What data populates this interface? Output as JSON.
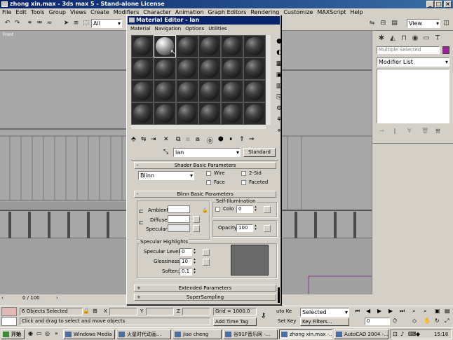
{
  "window": {
    "title": "zhong xin.max - 3ds max 5 - Stand-alone License"
  },
  "menu": [
    "File",
    "Edit",
    "Tools",
    "Group",
    "Views",
    "Create",
    "Modifiers",
    "Character",
    "Animation",
    "Graph Editors",
    "Rendering",
    "Customize",
    "MAXScript",
    "Help"
  ],
  "toolbar": {
    "selection_filter": "All",
    "ref_coord": "View"
  },
  "viewport": {
    "label": "Front",
    "frame_counter": "0 / 100"
  },
  "command_panel": {
    "name_field": "Multiple Selected",
    "modifier_list": "Modifier List"
  },
  "mat_editor": {
    "title": "Material Editor - lan",
    "menu": [
      "Material",
      "Navigation",
      "Options",
      "Utilities"
    ],
    "material_name": "lan",
    "material_type": "Standard",
    "shader_rollout": "Shader Basic Parameters",
    "shader_type": "Blinn",
    "wire": "Wire",
    "two_sided": "2-Sid",
    "face_map": "Face",
    "faceted": "Faceted",
    "blinn_rollout": "Blinn Basic Parameters",
    "self_illum_title": "Self-Illumination",
    "color_label": "Colo",
    "color_value": "0",
    "ambient": "Ambient:",
    "diffuse": "Diffuse:",
    "specular": "Specular:",
    "opacity_label": "Opacity:",
    "opacity_value": "100",
    "spec_title": "Specular Highlights",
    "spec_level_label": "Specular Level:",
    "spec_level": "0",
    "gloss_label": "Glossiness:",
    "gloss": "10",
    "soften_label": "Soften:",
    "soften": "0.1",
    "extended": "Extended Parameters",
    "supersampling": "SuperSampling",
    "selected_slot": 2
  },
  "status": {
    "selected": "6 Objects Selected",
    "x_label": "X",
    "y_label": "Y",
    "z_label": "Z",
    "grid": "Grid = 1000.0",
    "prompt": "Click and drag to select and move objects",
    "add_time_tag": "Add Time Tag",
    "auto_key": "uto Ke",
    "set_key": "Set Key",
    "key_mode": "Selected",
    "key_filters": "Key Filters...",
    "frame": "0"
  },
  "taskbar": {
    "start": "开始",
    "tasks": [
      "Windows Media ...",
      "火星时代动画...",
      "jiao cheng",
      "谷91F音乐网 -...",
      "zhong xin.max -...",
      "AutoCAD 2004 -..."
    ],
    "active_task": 4,
    "clock": "15:18"
  }
}
